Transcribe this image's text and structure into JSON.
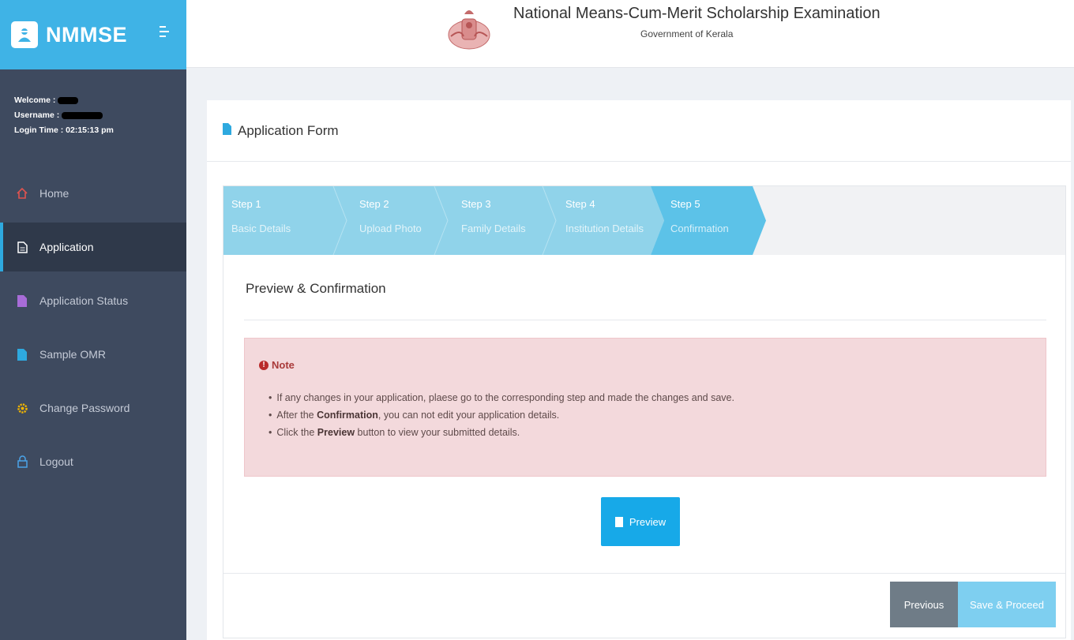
{
  "brand": {
    "name": "NMMSE"
  },
  "user": {
    "welcome_label": "Welcome :",
    "username_label": "Username :",
    "login_time": "Login Time : 02:15:13 pm"
  },
  "menu": [
    {
      "label": "Home",
      "icon": "home-icon",
      "color": "#e0534f"
    },
    {
      "label": "Application",
      "icon": "document-icon",
      "color": "#ffffff"
    },
    {
      "label": "Application Status",
      "icon": "file-icon",
      "color": "#a86cd8"
    },
    {
      "label": "Sample OMR",
      "icon": "file-icon",
      "color": "#2ea9df"
    },
    {
      "label": "Change Password",
      "icon": "gear-icon",
      "color": "#f0b400"
    },
    {
      "label": "Logout",
      "icon": "lock-icon",
      "color": "#4aa3e8"
    }
  ],
  "header": {
    "title": "National Means-Cum-Merit Scholarship Examination",
    "subtitle": "Government of Kerala"
  },
  "page": {
    "title": "Application Form"
  },
  "steps": [
    {
      "step": "Step 1",
      "label": "Basic Details"
    },
    {
      "step": "Step 2",
      "label": "Upload Photo"
    },
    {
      "step": "Step 3",
      "label": "Family Details"
    },
    {
      "step": "Step 4",
      "label": "Institution Details"
    },
    {
      "step": "Step 5",
      "label": "Confirmation"
    }
  ],
  "section": {
    "title": "Preview & Confirmation"
  },
  "note": {
    "heading": "Note",
    "line1": "If any changes in your application, plaese go to the corresponding step and made the changes and save.",
    "line2_pre": "After the ",
    "line2_bold": "Confirmation",
    "line2_post": ", you can not edit your application details.",
    "line3_pre": "Click the ",
    "line3_bold": "Preview",
    "line3_post": " button to view your submitted details."
  },
  "buttons": {
    "preview": "Preview",
    "previous": "Previous",
    "save_proceed": "Save & Proceed"
  },
  "colors": {
    "brand": "#3fb3e6",
    "sidebar": "#3e4a5f",
    "step_done": "#90d3ea",
    "step_active": "#5cc2e8",
    "note_bg": "#f3d9dc"
  }
}
